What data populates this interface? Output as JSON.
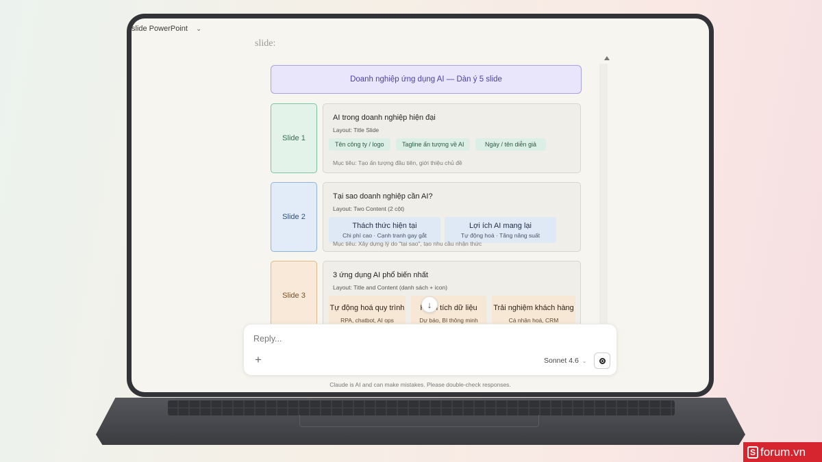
{
  "header": {
    "title": "slide PowerPoint"
  },
  "previous_text": "slide:",
  "diagram": {
    "banner": "Doanh nghiệp ứng dụng AI — Dàn ý 5 slide",
    "slides": [
      {
        "tag": "Slide 1",
        "title": "AI trong doanh nghiệp hiện đại",
        "layout": "Layout: Title Slide",
        "chips": [
          "Tên công ty / logo",
          "Tagline ấn tượng về AI",
          "Ngày / tên diễn giả"
        ],
        "goal": "Mục tiêu: Tạo ấn tượng đầu tiên, giới thiệu chủ đề"
      },
      {
        "tag": "Slide 2",
        "title": "Tại sao doanh nghiệp cần AI?",
        "layout": "Layout: Two Content (2 cột)",
        "columns": [
          {
            "head": "Thách thức hiện tại",
            "sub": "Chi phí cao · Cạnh tranh gay gắt"
          },
          {
            "head": "Lợi ích AI mang lại",
            "sub": "Tự động hoá · Tăng năng suất"
          }
        ],
        "goal": "Mục tiêu: Xây dựng lý do \"tại sao\", tạo nhu cầu nhận thức"
      },
      {
        "tag": "Slide 3",
        "title": "3 ứng dụng AI phổ biến nhất",
        "layout": "Layout: Title and Content (danh sách + icon)",
        "apps": [
          {
            "head": "Tự động hoá quy trình",
            "sub": "RPA, chatbot, AI ops"
          },
          {
            "head": "Phân tích dữ liệu",
            "sub": "Dự báo, BI thông minh"
          },
          {
            "head": "Trải nghiệm khách hàng",
            "sub": "Cá nhân hoá, CRM"
          }
        ]
      }
    ]
  },
  "reply": {
    "placeholder": "Reply...",
    "model": "Sonnet 4.6"
  },
  "disclaimer": "Claude is AI and can make mistakes. Please double-check responses.",
  "watermark": "forum.vn",
  "icons": {
    "dropdown": "chevron-down-icon",
    "scroll_down": "arrow-down-icon",
    "add": "plus-icon",
    "voice": "voice-mode-icon"
  }
}
